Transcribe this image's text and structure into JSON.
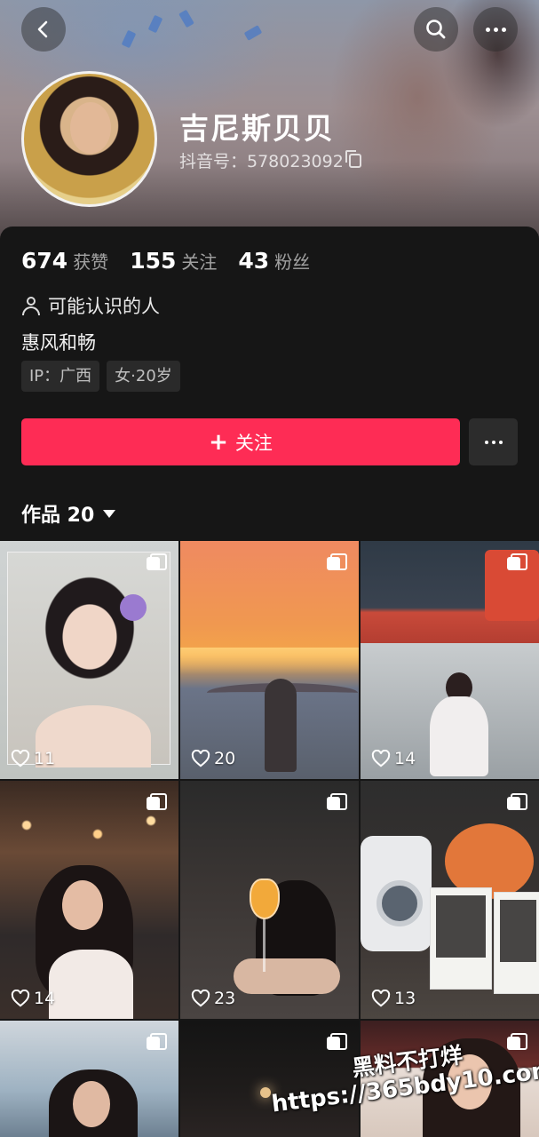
{
  "header": {
    "back_icon": "chevron-left-icon",
    "search_icon": "search-icon",
    "more_icon": "more-dots-icon"
  },
  "profile": {
    "nickname": "吉尼斯贝贝",
    "douyin_id": "抖音号：578023092",
    "copy_icon": "copy-icon"
  },
  "stats": [
    {
      "value": "674",
      "label": "获赞"
    },
    {
      "value": "155",
      "label": "关注"
    },
    {
      "value": "43",
      "label": "粉丝"
    }
  ],
  "may_know": "可能认识的人",
  "bio": "惠风和畅",
  "tags": [
    "IP：广西",
    "女·20岁"
  ],
  "actions": {
    "follow_plus": "+",
    "follow_label": "关注",
    "follow_color": "#fe2c55"
  },
  "works_tab": {
    "label": "作品 20"
  },
  "posts": [
    {
      "likes": "11"
    },
    {
      "likes": "20"
    },
    {
      "likes": "14"
    },
    {
      "likes": "14"
    },
    {
      "likes": "23"
    },
    {
      "likes": "13"
    },
    {
      "likes": ""
    },
    {
      "likes": ""
    },
    {
      "likes": ""
    }
  ],
  "watermark": {
    "line1": "黑料不打烊",
    "line2": "https://365bdy10.com"
  }
}
